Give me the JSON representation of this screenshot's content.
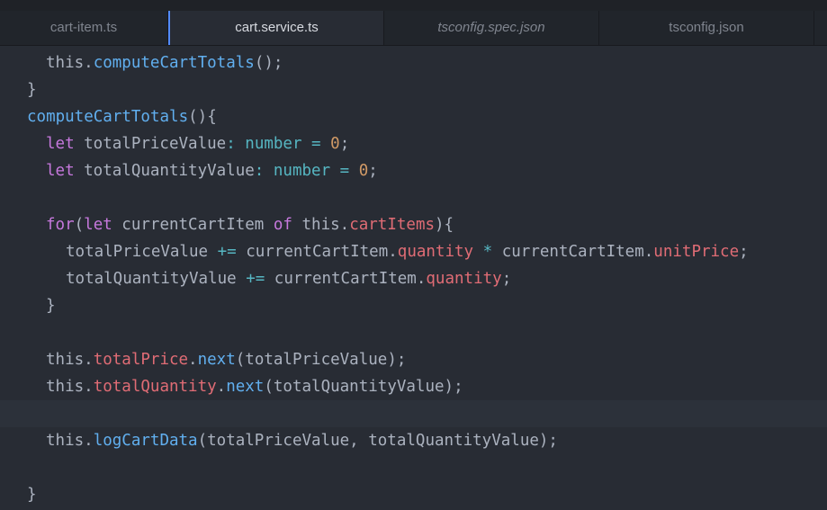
{
  "tabs": [
    {
      "label": "cart-item.ts"
    },
    {
      "label": "cart.service.ts"
    },
    {
      "label": "tsconfig.spec.json"
    },
    {
      "label": "tsconfig.json"
    }
  ],
  "code": {
    "l1": [
      "this",
      ".",
      "computeCartTotals",
      "();"
    ],
    "l2": [
      "}"
    ],
    "l3": [
      "computeCartTotals",
      "(){"
    ],
    "l4": [
      "let",
      " totalPriceValue",
      ":",
      " ",
      "number",
      " ",
      "=",
      " ",
      "0",
      ";"
    ],
    "l5": [
      "let",
      " totalQuantityValue",
      ":",
      " ",
      "number",
      " ",
      "=",
      " ",
      "0",
      ";"
    ],
    "l7": [
      "for",
      "(",
      "let",
      " currentCartItem ",
      "of",
      " this.",
      "cartItems",
      "){"
    ],
    "l8": [
      "totalPriceValue ",
      "+=",
      " currentCartItem.",
      "quantity",
      " ",
      "*",
      " currentCartItem.",
      "unitPrice",
      ";"
    ],
    "l9": [
      "totalQuantityValue ",
      "+=",
      " currentCartItem.",
      "quantity",
      ";"
    ],
    "l10": [
      "}"
    ],
    "l12": [
      "this.",
      "totalPrice",
      ".",
      "next",
      "(totalPriceValue);"
    ],
    "l13": [
      "this.",
      "totalQuantity",
      ".",
      "next",
      "(totalQuantityValue);"
    ],
    "l15": [
      "this.",
      "logCartData",
      "(totalPriceValue, totalQuantityValue);"
    ],
    "l17": [
      "}"
    ]
  }
}
